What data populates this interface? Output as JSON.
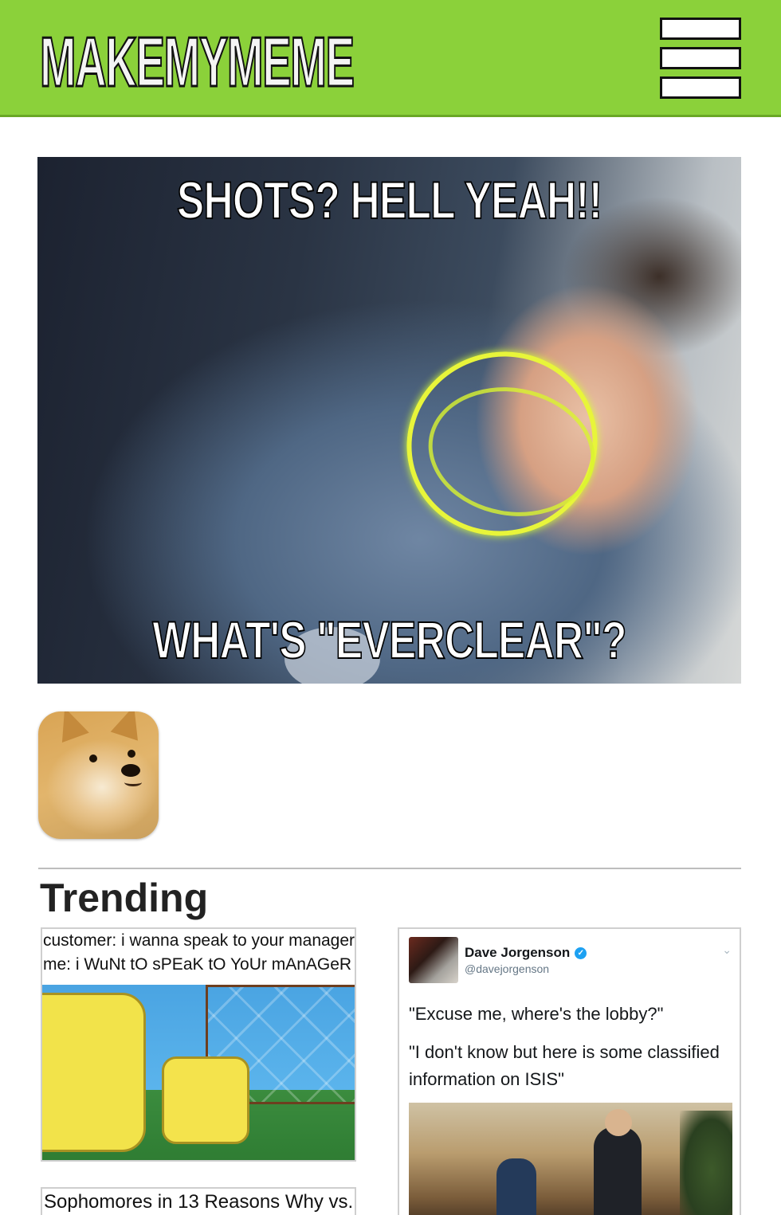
{
  "header": {
    "logo_text": "MakeMyMeme",
    "menu_icon": "hamburger-menu-icon",
    "colors": {
      "background": "#8bd13a",
      "border": "#6aa825"
    }
  },
  "meme": {
    "top_text": "SHOTS? HELL YEAH!!",
    "bottom_text": "WHAT'S \"EVERCLEAR\"?"
  },
  "template_icon": "doge-icon",
  "trending": {
    "title": "Trending",
    "cards": [
      {
        "lines": [
          "customer: i wanna speak to your manager",
          "me: i WuNt tO sPEaK tO YoUr mAnAGeR"
        ]
      },
      {
        "author": "Dave Jorgenson",
        "handle": "@davejorgenson",
        "text_1": "\"Excuse me, where's the lobby?\"",
        "text_2": "\"I don't know but here is some classified information on ISIS\""
      },
      {
        "lines": [
          "Sophomores in 13 Reasons Why vs."
        ]
      }
    ]
  }
}
